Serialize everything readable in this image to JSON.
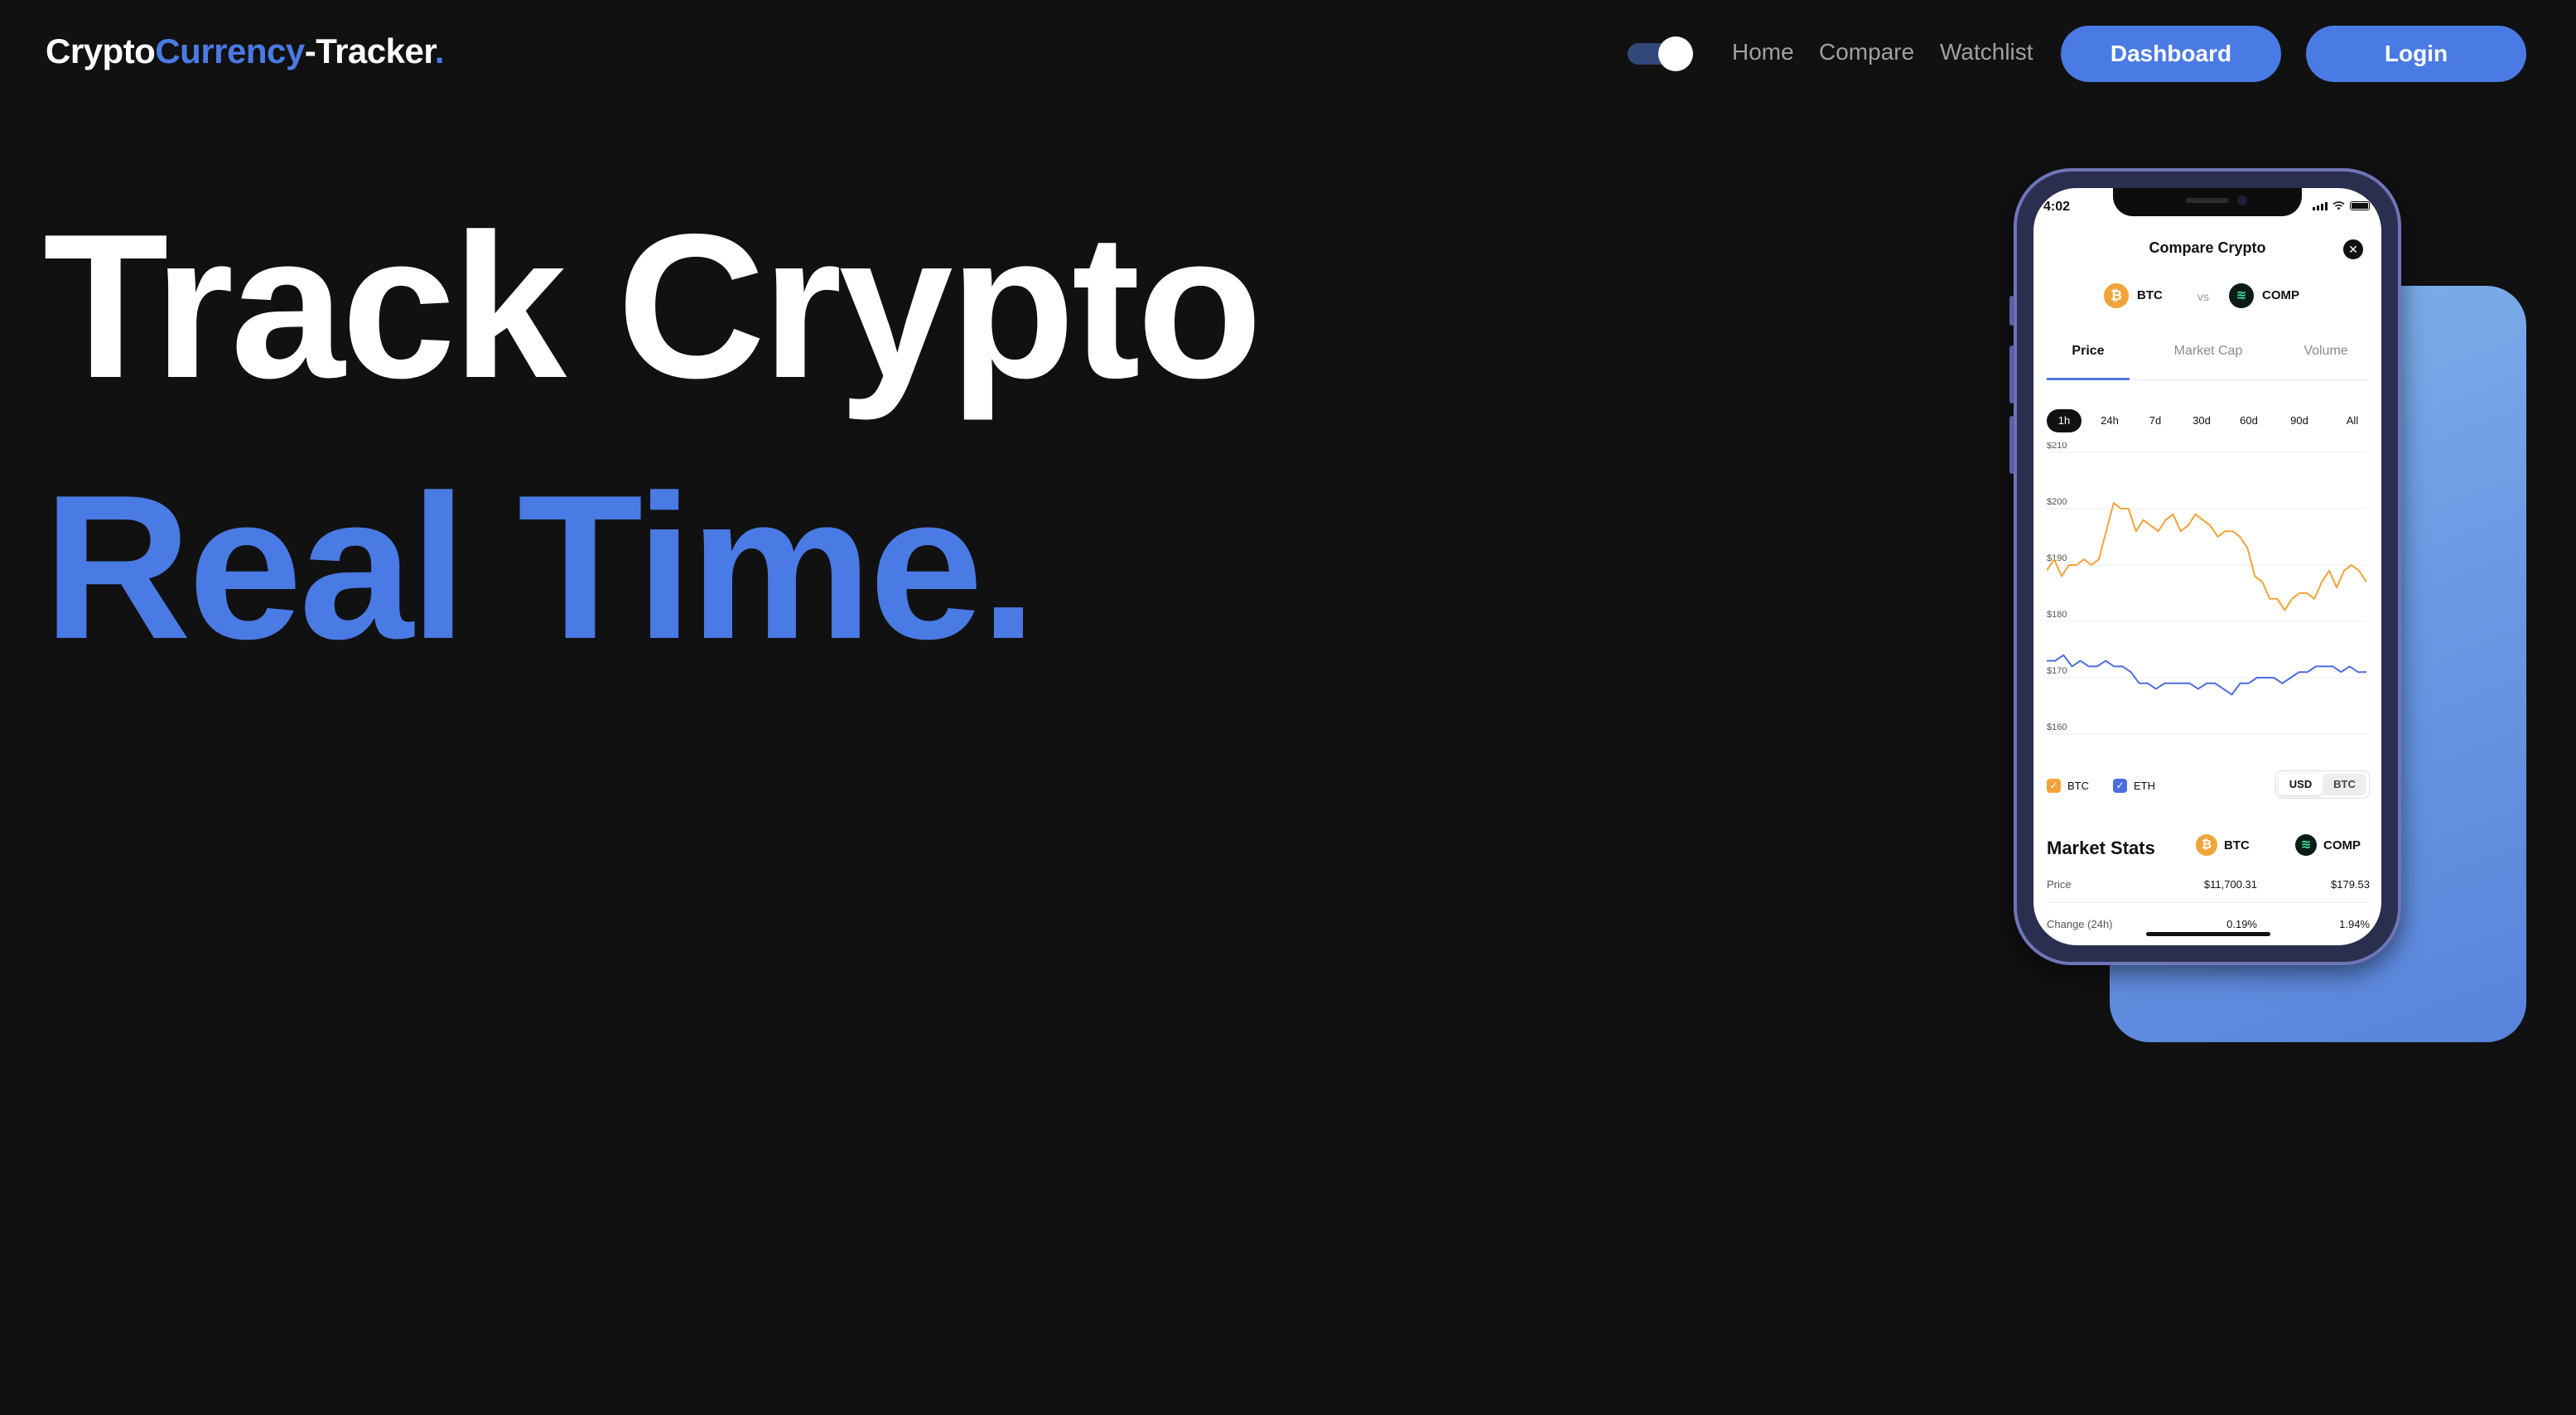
{
  "header": {
    "logo_part1": "Crypto",
    "logo_part2": "Currency",
    "logo_part3": "-Tracker",
    "logo_dot": ".",
    "nav": {
      "home": "Home",
      "compare": "Compare",
      "watchlist": "Watchlist"
    },
    "dashboard_label": "Dashboard",
    "login_label": "Login",
    "theme_toggle_on": true
  },
  "hero": {
    "line1": "Track Crypto",
    "line2": "Real Time."
  },
  "colors": {
    "accent": "#4a7ae3",
    "background": "#111111",
    "btc_orange": "#f2a33a",
    "eth_blue": "#4a6ee0"
  },
  "phone": {
    "status_time": "4:02",
    "title": "Compare Crypto",
    "close_icon": "close-icon",
    "coin1": "BTC",
    "vs": "vs",
    "coin2": "COMP",
    "tabs": [
      "Price",
      "Market Cap",
      "Volume"
    ],
    "active_tab": "Price",
    "ranges": [
      "1h",
      "24h",
      "7d",
      "30d",
      "60d",
      "90d",
      "All"
    ],
    "active_range": "1h",
    "legend": [
      "BTC",
      "ETH"
    ],
    "currency_options": [
      "USD",
      "BTC"
    ],
    "active_currency": "USD",
    "stats_title": "Market Stats",
    "stats_coin1": "BTC",
    "stats_coin2": "COMP",
    "stats_rows": [
      {
        "label": "Price",
        "v1": "$11,700.31",
        "v2": "$179.53"
      },
      {
        "label": "Change (24h)",
        "v1": "0.19%",
        "v2": "1.94%"
      }
    ]
  },
  "chart_data": {
    "type": "line",
    "ylim": [
      160,
      210
    ],
    "yticks": [
      "$210",
      "$200",
      "$190",
      "$180",
      "$170",
      "$160"
    ],
    "series": [
      {
        "name": "BTC",
        "color": "#f2a33a",
        "values": [
          189,
          191,
          188,
          190,
          190,
          191,
          190,
          191,
          196,
          201,
          200,
          200,
          196,
          198,
          197,
          196,
          198,
          199,
          196,
          197,
          199,
          198,
          197,
          195,
          196,
          196,
          195,
          193,
          188,
          187,
          184,
          184,
          182,
          184,
          185,
          185,
          184,
          187,
          189,
          186,
          189,
          190,
          189,
          187
        ]
      },
      {
        "name": "ETH",
        "color": "#4a6ee0",
        "values": [
          173,
          173,
          174,
          172,
          173,
          172,
          172,
          173,
          172,
          172,
          171,
          169,
          169,
          168,
          169,
          169,
          169,
          169,
          168,
          169,
          169,
          168,
          167,
          169,
          169,
          170,
          170,
          170,
          169,
          170,
          171,
          171,
          172,
          172,
          172,
          171,
          172,
          171,
          171
        ]
      }
    ]
  }
}
